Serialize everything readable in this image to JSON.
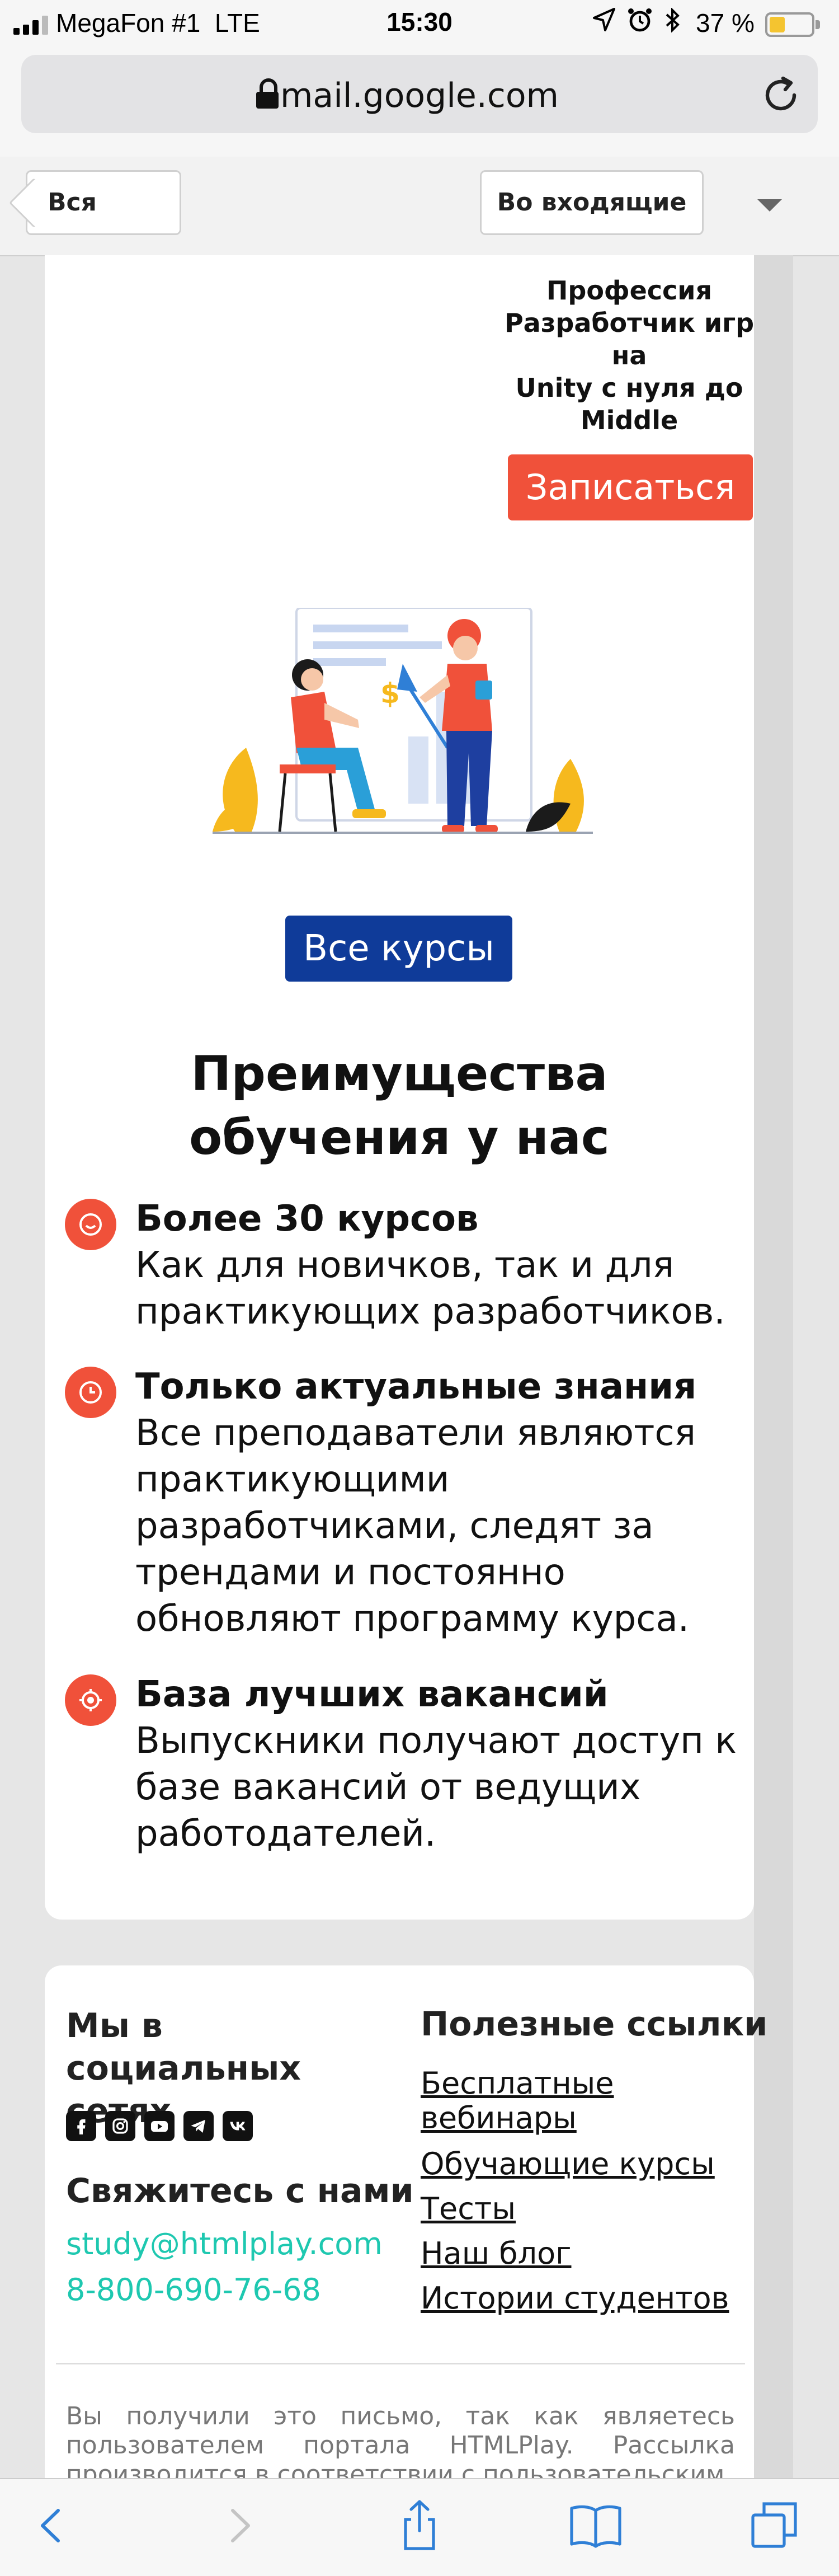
{
  "status_bar": {
    "carrier": "MegaFon #1",
    "network": "LTE",
    "time": "15:30",
    "battery_percent": "37 %",
    "battery_level": 0.37,
    "icons": [
      "location-icon",
      "alarm-icon",
      "bluetooth-icon"
    ]
  },
  "browser": {
    "url": "mail.google.com",
    "lock_icon": "lock-icon",
    "reload_icon": "reload-icon"
  },
  "mail_toolbar": {
    "back_label": "Вся по...",
    "folder_label": "Во входящие",
    "dropdown_icon": "caret-down-icon"
  },
  "email": {
    "course_title": "Профессия\nРазработчик игр\nна\nUnity с нуля до\nMiddle",
    "signup_label": "Записаться",
    "all_courses_label": "Все курсы",
    "benefits_title": "Преимущества обучения у нас",
    "benefits": [
      {
        "icon": "smile-icon",
        "title": "Более 30 курсов",
        "text": "Как для новичков, так и для\nпрактикующих разработчиков."
      },
      {
        "icon": "clock-icon",
        "title": "Только актуальные знания",
        "text": "Все преподаватели являются\nпрактикующими\nразработчиками, следят за\nтрендами и постоянно\nобновляют программу курса."
      },
      {
        "icon": "target-icon",
        "title": "База лучших вакансий",
        "text": "Выпускники получают доступ к\nбазе вакансий от ведущих\nработодателей."
      }
    ],
    "accent_color": "#f0513a",
    "button_color": "#0f3b99"
  },
  "footer": {
    "social_heading": "Мы в социальных сетях",
    "social_icons": [
      "facebook-icon",
      "instagram-icon",
      "youtube-icon",
      "telegram-icon",
      "vk-icon"
    ],
    "contact_heading": "Свяжитесь с нами",
    "email": "study@htmlplay.com",
    "phone": "8-800-690-76-68",
    "links_heading": "Полезные ссылки",
    "links": [
      "Бесплатные вебинары",
      "Обучающие курсы",
      "Тесты",
      "Наш блог",
      "Истории студентов"
    ],
    "disclaimer": "Вы получили это письмо, так как являетесь пользователем портала HTMLPlay. Рассылка производится в соответствии с пользовательским",
    "link_color": "#1ec8b0"
  },
  "safari_toolbar": {
    "icons": [
      "back-arrow-icon",
      "forward-arrow-icon",
      "share-icon",
      "bookmarks-icon",
      "tabs-icon"
    ]
  }
}
